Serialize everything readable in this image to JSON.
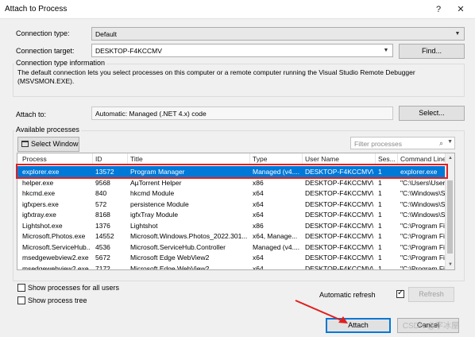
{
  "window": {
    "title": "Attach to Process",
    "help_glyph": "?",
    "close_glyph": "✕"
  },
  "connection": {
    "type_label": "Connection type:",
    "type_value": "Default",
    "target_label": "Connection target:",
    "target_value": "DESKTOP-F4KCCMV",
    "find_label": "Find..."
  },
  "info": {
    "title": "Connection type information",
    "text": "The default connection lets you select processes on this computer or a remote computer running the Visual Studio Remote Debugger (MSVSMON.EXE)."
  },
  "attach_to": {
    "label": "Attach to:",
    "value": "Automatic: Managed (.NET 4.x) code",
    "select_label": "Select..."
  },
  "processes": {
    "title": "Available processes",
    "select_window_label": "Select Window",
    "filter_placeholder": "Filter processes",
    "columns": [
      "Process",
      "ID",
      "Title",
      "Type",
      "User Name",
      "Ses...",
      "Command Line"
    ],
    "rows": [
      [
        "explorer.exe",
        "13572",
        "Program Manager",
        "Managed (v4....",
        "DESKTOP-F4KCCMV\\...",
        "1",
        "explorer.exe"
      ],
      [
        "helper.exe",
        "9568",
        "AµTorrent Helper",
        "x86",
        "DESKTOP-F4KCCMV\\...",
        "1",
        "\"C:\\Users\\User"
      ],
      [
        "hkcmd.exe",
        "840",
        "hkcmd Module",
        "x64",
        "DESKTOP-F4KCCMV\\...",
        "1",
        "\"C:\\Windows\\S"
      ],
      [
        "igfxpers.exe",
        "572",
        "persistence Module",
        "x64",
        "DESKTOP-F4KCCMV\\...",
        "1",
        "\"C:\\Windows\\S"
      ],
      [
        "igfxtray.exe",
        "8168",
        "igfxTray Module",
        "x64",
        "DESKTOP-F4KCCMV\\...",
        "1",
        "\"C:\\Windows\\S"
      ],
      [
        "Lightshot.exe",
        "1376",
        "Lightshot",
        "x86",
        "DESKTOP-F4KCCMV\\...",
        "1",
        "\"C:\\Program Fi"
      ],
      [
        "Microsoft.Photos.exe",
        "14552",
        "Microsoft.Windows.Photos_2022.301...",
        "x64, Manage...",
        "DESKTOP-F4KCCMV\\...",
        "1",
        "\"C:\\Program Fi"
      ],
      [
        "Microsoft.ServiceHub...",
        "4536",
        "Microsoft.ServiceHub.Controller",
        "Managed (v4....",
        "DESKTOP-F4KCCMV\\...",
        "1",
        "\"C:\\Program Fi"
      ],
      [
        "msedgewebview2.exe",
        "5672",
        "Microsoft Edge WebView2",
        "x64",
        "DESKTOP-F4KCCMV\\...",
        "1",
        "\"C:\\Program Fi"
      ],
      [
        "msedgewebview2.exe",
        "7172",
        "Microsoft Edge WebView2",
        "x64",
        "DESKTOP-F4KCCMV\\...",
        "1",
        "\"C:\\Program Fi"
      ]
    ],
    "selected_row": 0
  },
  "options": {
    "show_all_users": "Show processes for all users",
    "show_tree": "Show process tree",
    "auto_refresh": "Automatic refresh",
    "refresh_label": "Refresh"
  },
  "footer": {
    "attach_label": "Attach",
    "cancel_label": "Cancel",
    "watermark": "CSDN @字冰屋"
  },
  "colors": {
    "selection": "#0078d7",
    "highlight_box": "#e02020",
    "arrow": "#e02020"
  }
}
